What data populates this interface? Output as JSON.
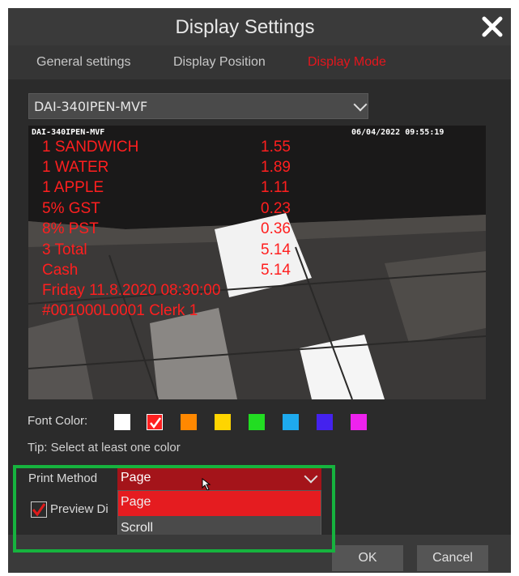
{
  "dialog": {
    "title": "Display Settings",
    "close_icon": "close-icon"
  },
  "tabs": [
    {
      "label": "General settings",
      "active": false
    },
    {
      "label": "Display Position",
      "active": false
    },
    {
      "label": "Display Mode",
      "active": true
    }
  ],
  "channel_select": {
    "value": "DAI-340IPEN-MVF"
  },
  "preview": {
    "camera_name": "DAI-340IPEN-MVF",
    "timestamp": "06/04/2022 09:55:19",
    "receipt_lines": [
      {
        "left": "1  SANDWICH",
        "right": "1.55"
      },
      {
        "left": "1  WATER",
        "right": "1.89"
      },
      {
        "left": "1  APPLE",
        "right": "1.11"
      },
      {
        "left": "5% GST",
        "right": "0.23"
      },
      {
        "left": "8% PST",
        "right": "0.36"
      },
      {
        "left": "3  Total",
        "right": "5.14"
      },
      {
        "left": "Cash",
        "right": "5.14"
      },
      {
        "left": "Friday   11.8.2020   08:30:00",
        "right": ""
      },
      {
        "left": "#001000L0001 Clerk 1",
        "right": ""
      }
    ]
  },
  "font_color": {
    "label": "Font Color:",
    "swatches": [
      {
        "color": "#ffffff",
        "checked": false
      },
      {
        "color": "#ff2020",
        "checked": true
      },
      {
        "color": "#ff8800",
        "checked": false
      },
      {
        "color": "#ffd500",
        "checked": false
      },
      {
        "color": "#22dd22",
        "checked": false
      },
      {
        "color": "#1eaaee",
        "checked": false
      },
      {
        "color": "#4422ee",
        "checked": false
      },
      {
        "color": "#ee22ee",
        "checked": false
      }
    ]
  },
  "tip": "Tip: Select at least one color",
  "print_method": {
    "label": "Print Method",
    "value": "Page",
    "options": [
      "Page",
      "Scroll"
    ],
    "selected_index": 0
  },
  "preview_checkbox": {
    "label": "Preview Di",
    "checked": true
  },
  "buttons": {
    "ok": "OK",
    "cancel": "Cancel"
  },
  "colors": {
    "accent": "#e5161d",
    "highlight_border": "#16b33e",
    "dialog_bg": "#2b2b2b"
  }
}
